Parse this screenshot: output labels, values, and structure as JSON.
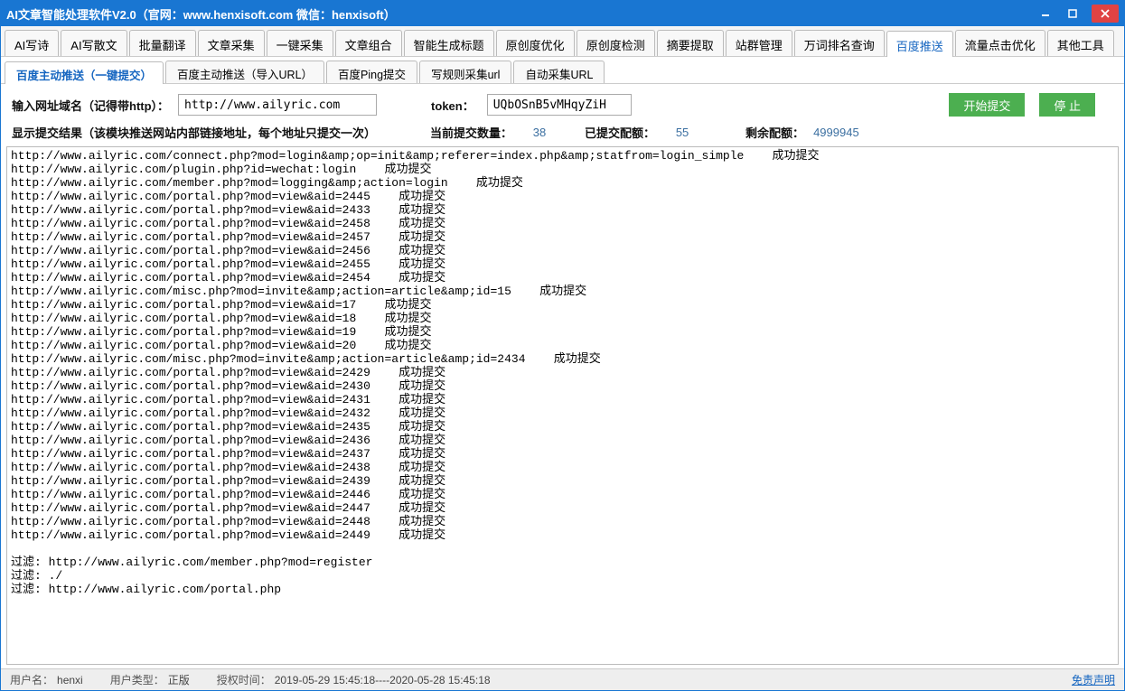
{
  "title": "AI文章智能处理软件V2.0（官网：www.henxisoft.com  微信：henxisoft）",
  "mainTabs": [
    "AI写诗",
    "AI写散文",
    "批量翻译",
    "文章采集",
    "一键采集",
    "文章组合",
    "智能生成标题",
    "原创度优化",
    "原创度检测",
    "摘要提取",
    "站群管理",
    "万词排名查询",
    "百度推送",
    "流量点击优化",
    "其他工具"
  ],
  "activeMainTab": 12,
  "subTabs": [
    "百度主动推送（一键提交）",
    "百度主动推送（导入URL）",
    "百度Ping提交",
    "写规则采集url",
    "自动采集URL"
  ],
  "activeSubTab": 0,
  "form": {
    "urlLabel": "输入网址域名（记得带http）：",
    "urlValue": "http://www.ailyric.com",
    "tokenLabel": "token：",
    "tokenValue": "UQbOSnB5vMHqyZiH",
    "startBtn": "开始提交",
    "stopBtn": "停 止"
  },
  "status": {
    "resultLabel": "显示提交结果（该模块推送网站内部链接地址，每个地址只提交一次）",
    "countLabel": "当前提交数量：",
    "countValue": "38",
    "usedLabel": "已提交配额：",
    "usedValue": "55",
    "remainLabel": "剩余配额：",
    "remainValue": "4999945"
  },
  "resultLines": [
    "http://www.ailyric.com/connect.php?mod=login&amp;op=init&amp;referer=index.php&amp;statfrom=login_simple    成功提交",
    "http://www.ailyric.com/plugin.php?id=wechat:login    成功提交",
    "http://www.ailyric.com/member.php?mod=logging&amp;action=login    成功提交",
    "http://www.ailyric.com/portal.php?mod=view&aid=2445    成功提交",
    "http://www.ailyric.com/portal.php?mod=view&aid=2433    成功提交",
    "http://www.ailyric.com/portal.php?mod=view&aid=2458    成功提交",
    "http://www.ailyric.com/portal.php?mod=view&aid=2457    成功提交",
    "http://www.ailyric.com/portal.php?mod=view&aid=2456    成功提交",
    "http://www.ailyric.com/portal.php?mod=view&aid=2455    成功提交",
    "http://www.ailyric.com/portal.php?mod=view&aid=2454    成功提交",
    "http://www.ailyric.com/misc.php?mod=invite&amp;action=article&amp;id=15    成功提交",
    "http://www.ailyric.com/portal.php?mod=view&aid=17    成功提交",
    "http://www.ailyric.com/portal.php?mod=view&aid=18    成功提交",
    "http://www.ailyric.com/portal.php?mod=view&aid=19    成功提交",
    "http://www.ailyric.com/portal.php?mod=view&aid=20    成功提交",
    "http://www.ailyric.com/misc.php?mod=invite&amp;action=article&amp;id=2434    成功提交",
    "http://www.ailyric.com/portal.php?mod=view&aid=2429    成功提交",
    "http://www.ailyric.com/portal.php?mod=view&aid=2430    成功提交",
    "http://www.ailyric.com/portal.php?mod=view&aid=2431    成功提交",
    "http://www.ailyric.com/portal.php?mod=view&aid=2432    成功提交",
    "http://www.ailyric.com/portal.php?mod=view&aid=2435    成功提交",
    "http://www.ailyric.com/portal.php?mod=view&aid=2436    成功提交",
    "http://www.ailyric.com/portal.php?mod=view&aid=2437    成功提交",
    "http://www.ailyric.com/portal.php?mod=view&aid=2438    成功提交",
    "http://www.ailyric.com/portal.php?mod=view&aid=2439    成功提交",
    "http://www.ailyric.com/portal.php?mod=view&aid=2446    成功提交",
    "http://www.ailyric.com/portal.php?mod=view&aid=2447    成功提交",
    "http://www.ailyric.com/portal.php?mod=view&aid=2448    成功提交",
    "http://www.ailyric.com/portal.php?mod=view&aid=2449    成功提交",
    "",
    "过滤: http://www.ailyric.com/member.php?mod=register",
    "过滤: ./",
    "过滤: http://www.ailyric.com/portal.php"
  ],
  "footer": {
    "userLabel": "用户名：",
    "userValue": "henxi",
    "typeLabel": "用户类型：",
    "typeValue": "正版",
    "authLabel": "授权时间：",
    "authValue": "2019-05-29 15:45:18----2020-05-28 15:45:18",
    "disclaimer": "免责声明"
  }
}
